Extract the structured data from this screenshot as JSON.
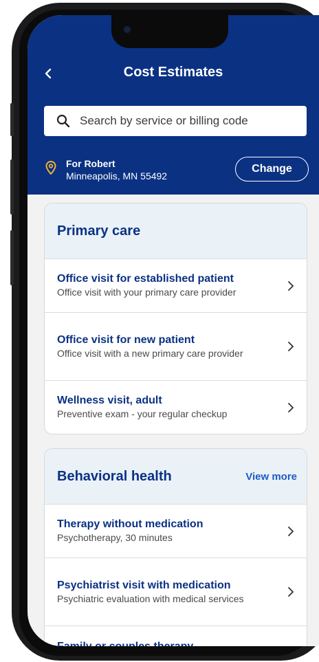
{
  "header": {
    "title": "Cost Estimates",
    "search_placeholder": "Search by service or billing code",
    "location": {
      "name": "For Robert",
      "city": "Minneapolis, MN 55492"
    },
    "change_label": "Change"
  },
  "colors": {
    "brand": "#0b3183",
    "card_header": "#eaf2f7",
    "link": "#1f5bc4"
  },
  "sections": [
    {
      "title": "Primary care",
      "items": [
        {
          "title": "Office visit for established patient",
          "subtitle": "Office visit with your primary care provider"
        },
        {
          "title": "Office visit for new patient",
          "subtitle": "Office visit with a new primary care provider"
        },
        {
          "title": "Wellness visit, adult",
          "subtitle": "Preventive exam - your regular checkup"
        }
      ]
    },
    {
      "title": "Behavioral health",
      "view_more": "View more",
      "items": [
        {
          "title": "Therapy without medication",
          "subtitle": "Psychotherapy, 30 minutes"
        },
        {
          "title": "Psychiatrist visit with medication",
          "subtitle": "Psychiatric evaluation with medical services"
        },
        {
          "title": "Family or couples therapy",
          "subtitle": ""
        }
      ]
    }
  ]
}
